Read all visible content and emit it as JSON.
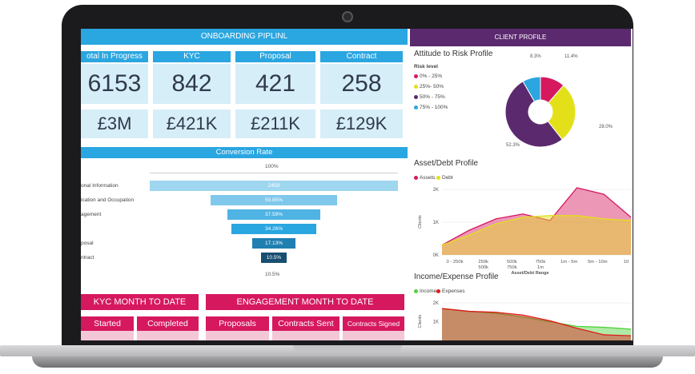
{
  "left": {
    "title": "ONBOARDING PIPLINL",
    "cards": [
      {
        "label": "otal In Progress",
        "count": "6153",
        "amount": "£3M"
      },
      {
        "label": "KYC",
        "count": "842",
        "amount": "£421K"
      },
      {
        "label": "Proposal",
        "count": "421",
        "amount": "£211K"
      },
      {
        "label": "Contract",
        "count": "258",
        "amount": "£129K"
      }
    ],
    "conversion_title": "Conversion Rate",
    "kyc_month": "KYC MONTH TO DATE",
    "engagement_month": "ENGAGEMENT MONTH TO DATE",
    "tabs": [
      "Started",
      "Completed",
      "Proposals",
      "Contracts Sent",
      "Contracts Signed"
    ]
  },
  "right": {
    "header": "CLIENT PROFILE",
    "risk_title": "Attitude to Risk Profile",
    "asset_title": "Asset/Debt Profile",
    "income_title": "Income/Expense Profile"
  },
  "chart_data": [
    {
      "type": "bar",
      "title": "Conversion Rate",
      "top_label": "100%",
      "bottom_label": "10.5%",
      "categories": [
        "onal Information",
        "ication and Occupation",
        "agement",
        "",
        "posal",
        "ntract"
      ],
      "values": [
        2458,
        50.85,
        37.59,
        34.26,
        17.13,
        10.5
      ],
      "value_labels": [
        "2458",
        "50.85%",
        "37.59%",
        "34.26%",
        "17.13%",
        "10.5%"
      ],
      "widths_pct": [
        100,
        50.85,
        37.59,
        34.26,
        17.13,
        10.5
      ],
      "colors": [
        "#9fd6f0",
        "#7fc8ec",
        "#4fb3e4",
        "#2aa6e0",
        "#1f7fb0",
        "#174e72"
      ]
    },
    {
      "type": "pie",
      "title": "Attitude to Risk Profile",
      "legend_title": "Risk level",
      "labels": [
        "0% - 25%",
        "25%- 50%",
        "50% - 75%",
        "75% - 100%"
      ],
      "values": [
        11.4,
        28.0,
        52.3,
        8.3
      ],
      "value_labels": [
        "11.4%",
        "28.0%",
        "52.3%",
        "8.3%"
      ],
      "colors": [
        "#d6185f",
        "#e3e01a",
        "#5b2a6e",
        "#2aa6e0"
      ]
    },
    {
      "type": "area",
      "title": "Asset/Debt Profile",
      "categories": [
        "0 - 250k",
        "250k - 500k",
        "500k - 750k",
        "750k - 1m",
        "1m - 5m",
        "5m - 10m",
        "10"
      ],
      "category_lines": [
        [
          "0 - 250k"
        ],
        [
          "250k",
          "500k"
        ],
        [
          "500k",
          "750k"
        ],
        [
          "750k",
          "1m"
        ],
        [
          "1m - 5m"
        ],
        [
          "5m - 10m"
        ],
        [
          "10"
        ]
      ],
      "xlabel": "Asset/Debt Range",
      "ylabel": "Clients",
      "yticks": [
        "0K",
        "1K",
        "2K"
      ],
      "ylim": [
        0,
        2000
      ],
      "series": [
        {
          "name": "Assets",
          "color": "#d6185f",
          "values": [
            300,
            750,
            1100,
            1250,
            1050,
            2050,
            1850,
            1150
          ]
        },
        {
          "name": "Debt",
          "color": "#e3e01a",
          "values": [
            300,
            600,
            950,
            1150,
            1200,
            1200,
            1100,
            1050
          ]
        }
      ]
    },
    {
      "type": "area",
      "title": "Income/Expense Profile",
      "ylabel": "Clients",
      "yticks": [
        "1K",
        "2K"
      ],
      "ylim": [
        0,
        2000
      ],
      "series": [
        {
          "name": "Income",
          "color": "#4fd13a",
          "values": [
            1700,
            1550,
            1450,
            1250,
            1000,
            750,
            700,
            600
          ]
        },
        {
          "name": "Expenses",
          "color": "#e01b1b",
          "values": [
            1700,
            1550,
            1500,
            1350,
            1050,
            650,
            300,
            250
          ]
        }
      ]
    }
  ]
}
